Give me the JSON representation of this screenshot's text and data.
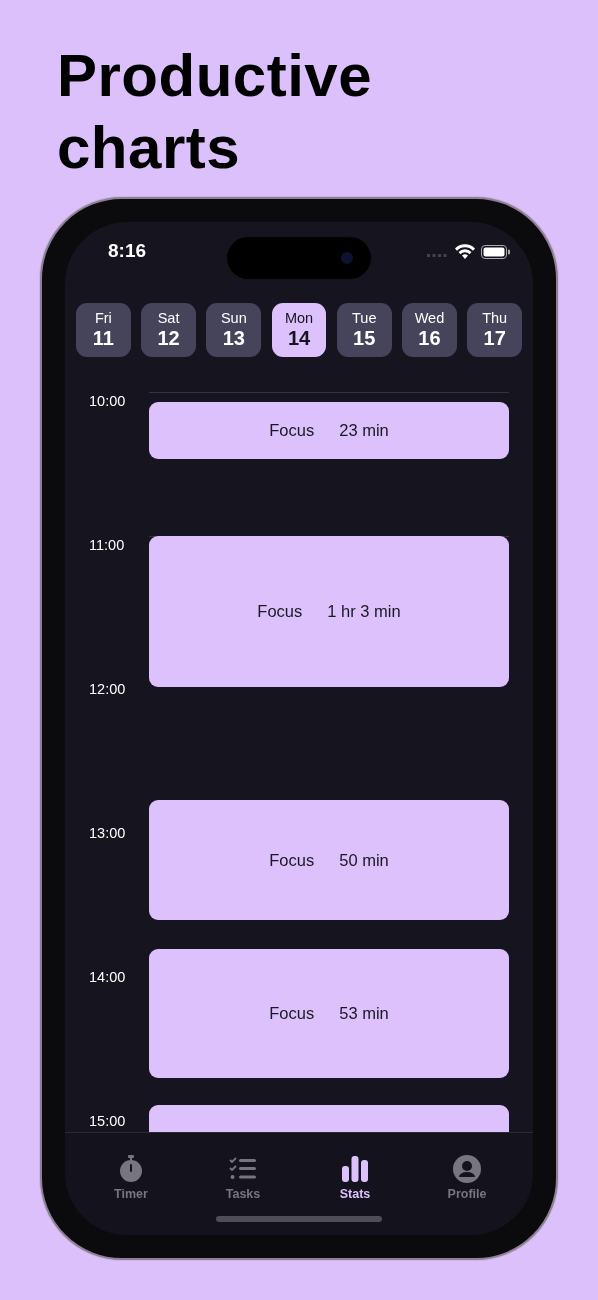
{
  "headline": "Productive charts",
  "status_bar": {
    "time": "8:16"
  },
  "days": [
    {
      "weekday": "Fri",
      "date": "11",
      "selected": false
    },
    {
      "weekday": "Sat",
      "date": "12",
      "selected": false
    },
    {
      "weekday": "Sun",
      "date": "13",
      "selected": false
    },
    {
      "weekday": "Mon",
      "date": "14",
      "selected": true
    },
    {
      "weekday": "Tue",
      "date": "15",
      "selected": false
    },
    {
      "weekday": "Wed",
      "date": "16",
      "selected": false
    },
    {
      "weekday": "Thu",
      "date": "17",
      "selected": false
    }
  ],
  "hours": [
    "10:00",
    "11:00",
    "12:00",
    "13:00",
    "14:00",
    "15:00"
  ],
  "sessions": [
    {
      "kind": "session",
      "label": "Focus",
      "duration": "23 min"
    },
    {
      "kind": "session",
      "label": "Focus",
      "duration": "1 hr 3 min"
    },
    {
      "kind": "session",
      "label": "Focus",
      "duration": "50 min"
    },
    {
      "kind": "session",
      "label": "Focus",
      "duration": "53 min"
    },
    {
      "kind": "cut"
    }
  ],
  "tabs": [
    {
      "label": "Timer",
      "selected": false
    },
    {
      "label": "Tasks",
      "selected": false
    },
    {
      "label": "Stats",
      "selected": true
    },
    {
      "label": "Profile",
      "selected": false
    }
  ]
}
